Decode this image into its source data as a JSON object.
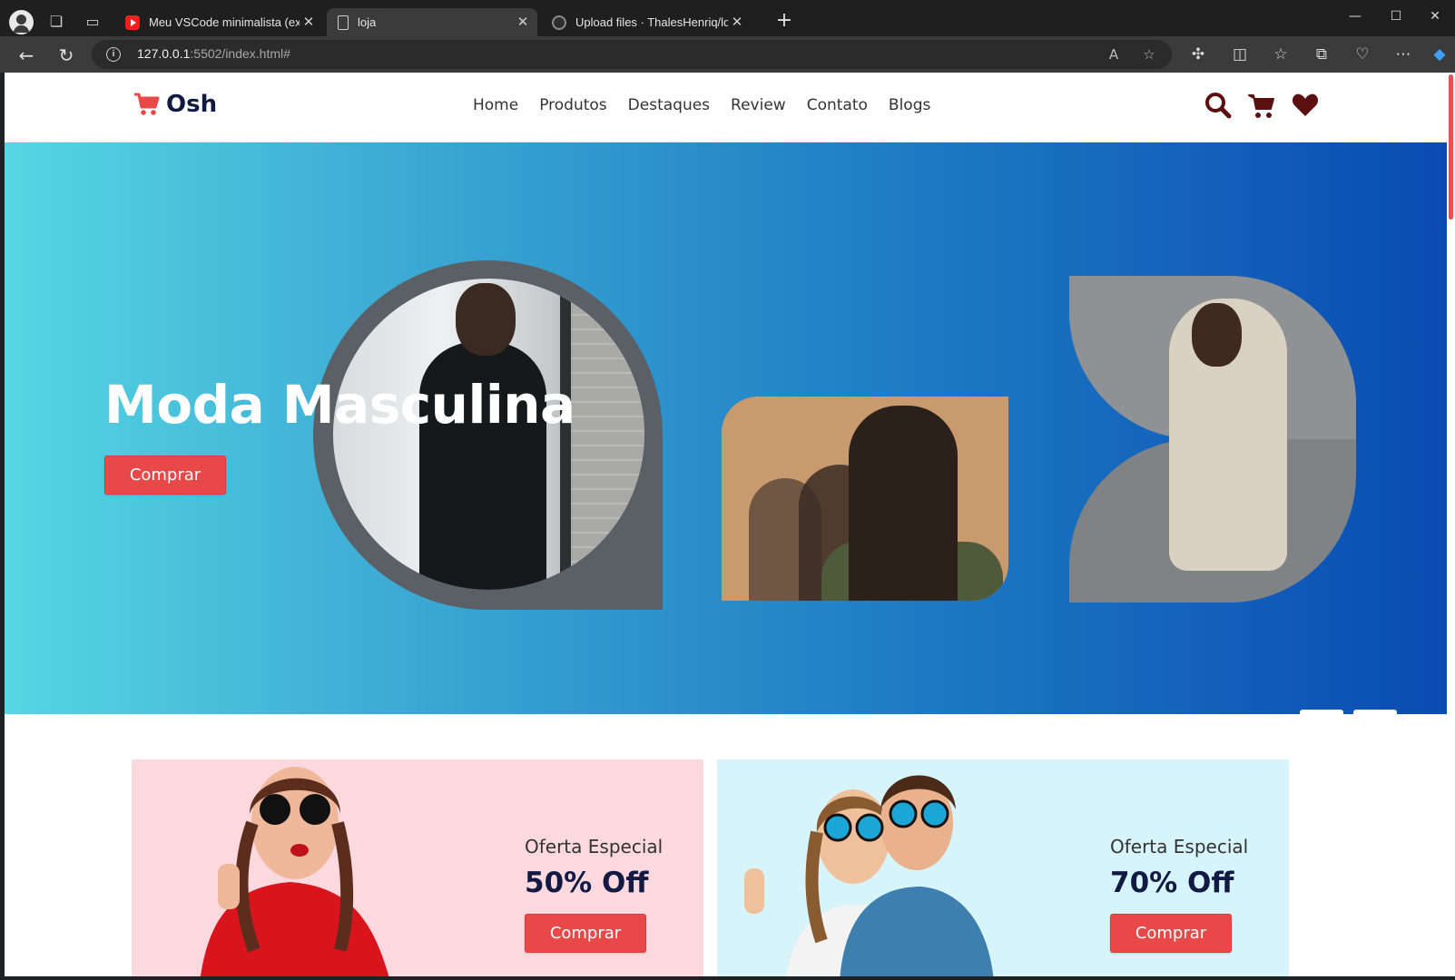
{
  "browser": {
    "tabs": [
      {
        "label": "Meu VSCode minimalista (extens",
        "active": false,
        "icon": "youtube-icon"
      },
      {
        "label": "loja",
        "active": true,
        "icon": "document-icon"
      },
      {
        "label": "Upload files · ThalesHenriq/loja",
        "active": false,
        "icon": "github-icon"
      }
    ],
    "url_host": "127.0.0.1",
    "url_rest": ":5502/index.html#"
  },
  "site": {
    "logo": "Osh",
    "nav": [
      "Home",
      "Produtos",
      "Destaques",
      "Review",
      "Contato",
      "Blogs"
    ],
    "header_icons": [
      "search-icon",
      "cart-icon",
      "heart-icon"
    ],
    "colors": {
      "accent": "#e94848",
      "dark": "#121a44",
      "icon": "#5a1010"
    }
  },
  "hero": {
    "title": "Moda Masculina",
    "button": "Comprar",
    "prev": "‹",
    "next": "›"
  },
  "offers": [
    {
      "subtitle": "Oferta Especial",
      "discount": "50% Off",
      "button": "Comprar",
      "bg": "#fcd9df"
    },
    {
      "subtitle": "Oferta Especial",
      "discount": "70% Off",
      "button": "Comprar",
      "bg": "#d6f4fa"
    }
  ]
}
